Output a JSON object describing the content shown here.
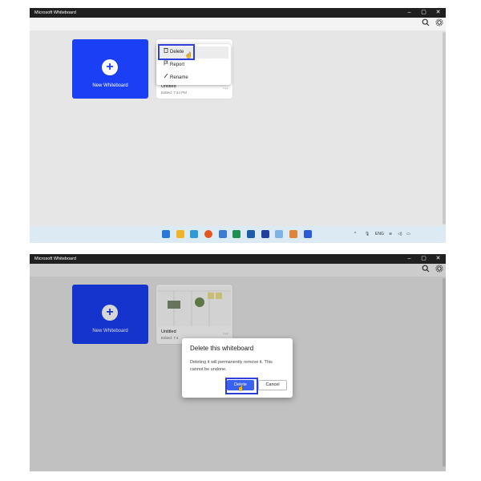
{
  "window": {
    "title": "Microsoft Whiteboard",
    "minimize": "–",
    "maximize": "▢",
    "close": "✕"
  },
  "toolbar": {
    "search_icon": "search-icon",
    "settings_icon": "gear-icon"
  },
  "new_whiteboard": {
    "label": "New Whiteboard",
    "icon": "+"
  },
  "board": {
    "name": "Untitled",
    "edited": "Edited: 7:44 PM",
    "edited_short": "Edited: 7:4",
    "more": "···"
  },
  "context_menu": {
    "items": [
      {
        "label": "Delete",
        "icon": "trash-icon"
      },
      {
        "label": "Report",
        "icon": "flag-icon"
      },
      {
        "label": "Rename",
        "icon": "pencil-icon"
      }
    ]
  },
  "taskbar": {
    "tray": {
      "language": "ENG",
      "caret": "^"
    },
    "apps": [
      "start",
      "file-explorer",
      "photos",
      "firefox",
      "notes",
      "spreadsheet",
      "store",
      "lens",
      "copilot",
      "paint",
      "whiteboard"
    ]
  },
  "dialog": {
    "title": "Delete this whiteboard",
    "message": "Deleting it will permanently remove it. This cannot be undone.",
    "delete_label": "Delete",
    "cancel_label": "Cancel"
  },
  "colors": {
    "accent": "#1a3ff5",
    "focus": "#2f3fd9",
    "button_primary": "#3a62f0",
    "titlebar": "#202020"
  }
}
